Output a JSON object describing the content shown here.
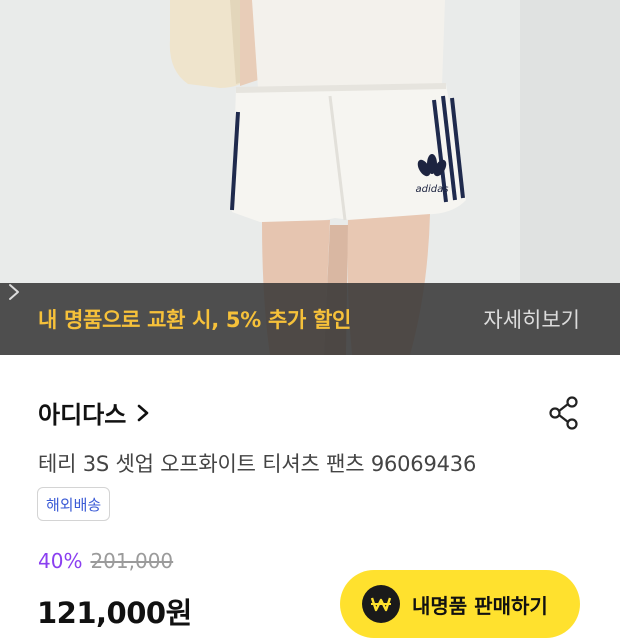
{
  "promo": {
    "text": "내 명품으로 교환 시, 5% 추가 할인",
    "detail_label": "자세히보기"
  },
  "product": {
    "brand": "아디다스",
    "name": "테리 3S 셋업 오프화이트 티셔츠 팬츠 96069436",
    "badge": "해외배송",
    "discount": "40%",
    "original_price": "201,000",
    "price": "121,000원",
    "image_logo_text": "adidas"
  },
  "actions": {
    "sell_label": "내명품 판매하기"
  },
  "colors": {
    "promo_text": "#f6c13a",
    "discount": "#8a3ff0",
    "sell_button": "#ffe12e",
    "badge_text": "#3b5bd6"
  }
}
